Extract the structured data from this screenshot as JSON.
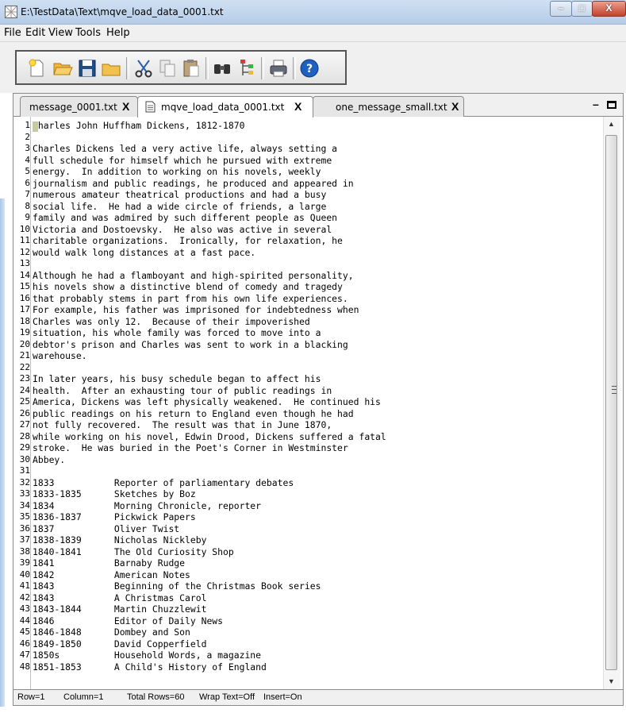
{
  "window": {
    "title": "E:\\TestData\\Text\\mqve_load_data_0001.txt",
    "minimize_label": "–",
    "maximize_label": "□",
    "close_label": "X"
  },
  "menu": {
    "items": [
      {
        "label": "File"
      },
      {
        "label": "Edit"
      },
      {
        "label": "View"
      },
      {
        "label": "Tools"
      },
      {
        "label": "Help"
      }
    ]
  },
  "toolbar": {
    "buttons": [
      {
        "icon": "new-file-icon"
      },
      {
        "icon": "open-folder-icon"
      },
      {
        "icon": "save-icon"
      },
      {
        "icon": "folder-icon"
      },
      {
        "icon": "cut-icon"
      },
      {
        "icon": "copy-icon"
      },
      {
        "icon": "paste-icon"
      },
      {
        "icon": "find-icon"
      },
      {
        "icon": "tree-view-icon"
      },
      {
        "icon": "print-icon"
      },
      {
        "icon": "help-icon"
      }
    ]
  },
  "tabs": [
    {
      "label": "message_0001.txt",
      "close": "X",
      "active": false
    },
    {
      "label": "mqve_load_data_0001.txt",
      "close": "X",
      "active": true
    },
    {
      "label": "one_message_small.txt",
      "close": "X",
      "active": false
    }
  ],
  "tab_controls": {
    "minimize": "–"
  },
  "editor": {
    "lines": [
      "Charles John Huffham Dickens, 1812-1870",
      "",
      "Charles Dickens led a very active life, always setting a",
      "full schedule for himself which he pursued with extreme",
      "energy.  In addition to working on his novels, weekly",
      "journalism and public readings, he produced and appeared in",
      "numerous amateur theatrical productions and had a busy",
      "social life.  He had a wide circle of friends, a large",
      "family and was admired by such different people as Queen",
      "Victoria and Dostoevsky.  He also was active in several",
      "charitable organizations.  Ironically, for relaxation, he",
      "would walk long distances at a fast pace.",
      "",
      "Although he had a flamboyant and high-spirited personality,",
      "his novels show a distinctive blend of comedy and tragedy",
      "that probably stems in part from his own life experiences.",
      "For example, his father was imprisoned for indebtedness when",
      "Charles was only 12.  Because of their impoverished",
      "situation, his whole family was forced to move into a",
      "debtor's prison and Charles was sent to work in a blacking",
      "warehouse.",
      "",
      "In later years, his busy schedule began to affect his",
      "health.  After an exhausting tour of public readings in",
      "America, Dickens was left physically weakened.  He continued his",
      "public readings on his return to England even though he had",
      "not fully recovered.  The result was that in June 1870,",
      "while working on his novel, Edwin Drood, Dickens suffered a fatal",
      "stroke.  He was buried in the Poet's Corner in Westminster",
      "Abbey.",
      "",
      "1833           Reporter of parliamentary debates",
      "1833-1835      Sketches by Boz",
      "1834           Morning Chronicle, reporter",
      "1836-1837      Pickwick Papers",
      "1837           Oliver Twist",
      "1838-1839      Nicholas Nickleby",
      "1840-1841      The Old Curiosity Shop",
      "1841           Barnaby Rudge",
      "1842           American Notes",
      "1843           Beginning of the Christmas Book series",
      "1843           A Christmas Carol",
      "1843-1844      Martin Chuzzlewit",
      "1846           Editor of Daily News",
      "1846-1848      Dombey and Son",
      "1849-1850      David Copperfield",
      "1850s          Household Words, a magazine",
      "1851-1853      A Child's History of England"
    ]
  },
  "status": {
    "row": "Row=1",
    "column": "Column=1",
    "total_rows": "Total Rows=60",
    "wrap": "Wrap Text=Off",
    "insert": "Insert=On"
  }
}
